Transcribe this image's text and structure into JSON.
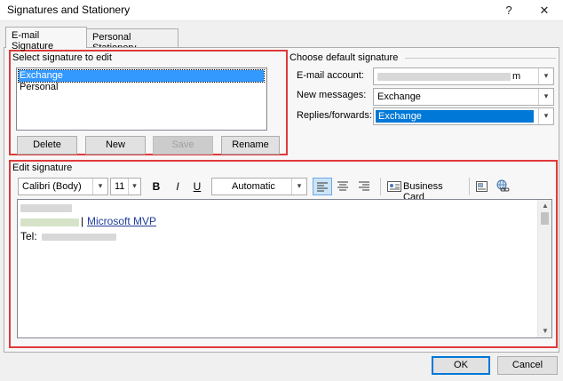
{
  "window": {
    "title": "Signatures and Stationery",
    "help_glyph": "?",
    "close_glyph": "✕"
  },
  "tabs": [
    {
      "label": "E-mail Signature",
      "active": true
    },
    {
      "label": "Personal Stationery",
      "active": false
    }
  ],
  "select_signature": {
    "label": "Select signature to edit",
    "items": [
      {
        "label": "Exchange",
        "selected": true
      },
      {
        "label": "Personal",
        "selected": false
      }
    ],
    "buttons": {
      "delete": "Delete",
      "new": "New",
      "save": "Save",
      "rename": "Rename"
    }
  },
  "default_signature": {
    "label": "Choose default signature",
    "email_account_label": "E-mail account:",
    "email_account_value_tail": "m",
    "new_messages_label": "New messages:",
    "new_messages_value": "Exchange",
    "replies_label": "Replies/forwards:",
    "replies_value": "Exchange"
  },
  "edit_signature": {
    "label": "Edit signature",
    "font_family": "Calibri (Body)",
    "font_size": "11",
    "bold": "B",
    "italic": "I",
    "underline": "U",
    "font_color": "Automatic",
    "business_card": "Business Card",
    "body": {
      "separator": "|",
      "mvp_link": "Microsoft MVP",
      "tel_label": "Tel:"
    }
  },
  "footer": {
    "ok": "OK",
    "cancel": "Cancel"
  },
  "colors": {
    "highlight_box": "#e03a3a",
    "selection": "#3399ff",
    "link": "#1f3d99"
  }
}
